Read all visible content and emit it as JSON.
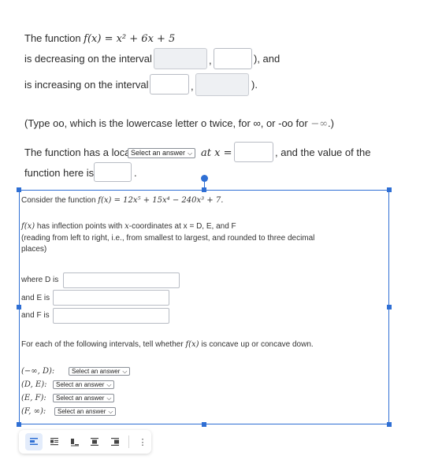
{
  "q1": {
    "line1_prefix": "The function ",
    "function_expr": "f(x) = x² + 6x + 5",
    "line2": "is decreasing on the interval (",
    "comma": ",",
    "line2_suffix": "), and",
    "line3": "is increasing on the interval (",
    "line3_suffix": ").",
    "note_prefix": "(Type oo, which is the lowercase letter o twice, for ∞, or -oo for ",
    "note_neg_inf": "−∞",
    "note_suffix": ".)",
    "local_prefix": "The function has a local",
    "select_label": "Select an answer",
    "at_x": "at x =",
    "value_suffix": ", and the value of the",
    "value_line": "function here is",
    "period": "."
  },
  "q2": {
    "intro_prefix": "Consider the function ",
    "function_expr": "f(x) = 12x⁵ + 15x⁴ − 240x³ + 7.",
    "inflection_a": "f(x)",
    "inflection_b": " has inflection points with ",
    "inflection_c": "x",
    "inflection_d": "-coordinates at x = D, E, and F",
    "reading_line1": "(reading from left to right, i.e., from smallest to largest, and rounded to three decimal",
    "reading_line2": "places)",
    "where_d": "where D is",
    "and_e": "and E is",
    "and_f": "and F is",
    "concavity_a": "For each of the following intervals, tell whether ",
    "concavity_b": "f(x)",
    "concavity_c": " is concave up or concave down.",
    "intervals": [
      {
        "label": "(−∞, D):",
        "select": "Select an answer"
      },
      {
        "label": "(D, E):",
        "select": "Select an answer"
      },
      {
        "label": "(E, F):",
        "select": "Select an answer"
      },
      {
        "label": "(F, ∞):",
        "select": "Select an answer"
      }
    ]
  },
  "toolbar": {
    "more": "⋮"
  },
  "colors": {
    "selection": "#2f6fd4"
  }
}
